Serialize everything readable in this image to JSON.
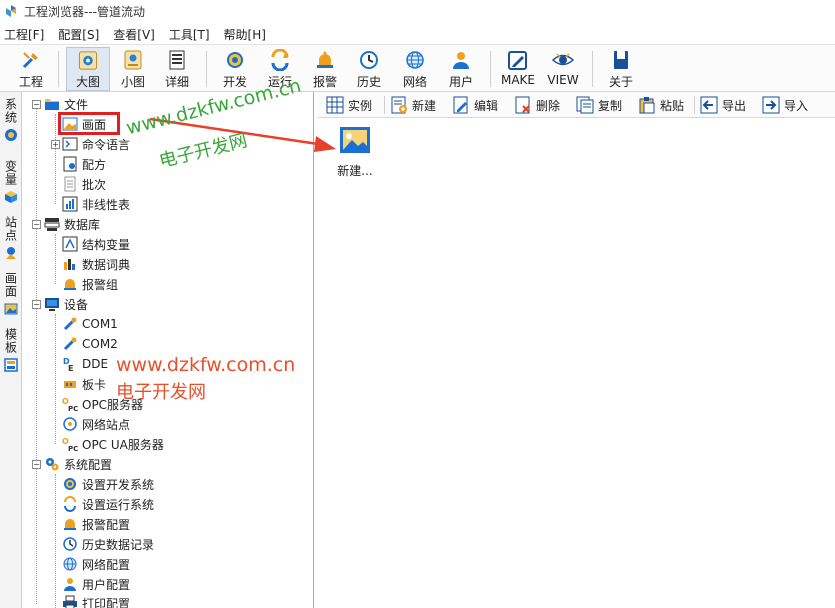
{
  "window": {
    "title": "工程浏览器---管道流动"
  },
  "menu": [
    {
      "label": "工程[F]",
      "id": "file"
    },
    {
      "label": "配置[S]",
      "id": "config"
    },
    {
      "label": "查看[V]",
      "id": "view"
    },
    {
      "label": "工具[T]",
      "id": "tools"
    },
    {
      "label": "帮助[H]",
      "id": "help"
    }
  ],
  "toolbar": {
    "project": "工程",
    "large": "大图",
    "small": "小图",
    "detail": "详细",
    "develop": "开发",
    "run": "运行",
    "alarm": "报警",
    "history": "历史",
    "network": "网络",
    "user": "用户",
    "make": "MAKE",
    "view": "VIEW",
    "about": "关于"
  },
  "vtabs": {
    "system": "系统",
    "variables": "变量",
    "sites": "站点",
    "screens": "画面",
    "templates": "模板"
  },
  "tree": {
    "file": "文件",
    "screen": "画面",
    "command": "命令语言",
    "recipe": "配方",
    "batch": "批次",
    "nonlinear": "非线性表",
    "database": "数据库",
    "struct_var": "结构变量",
    "data_dict": "数据词典",
    "alarm_group": "报警组",
    "device": "设备",
    "com1": "COM1",
    "com2": "COM2",
    "dde": "DDE",
    "board": "板卡",
    "opc": "OPC服务器",
    "net_site": "网络站点",
    "opcua": "OPC UA服务器",
    "sys_config": "系统配置",
    "set_dev": "设置开发系统",
    "set_run": "设置运行系统",
    "alarm_config": "报警配置",
    "history_record": "历史数据记录",
    "net_config": "网络配置",
    "user_config": "用户配置",
    "print_config": "打印配置"
  },
  "right_toolbar": {
    "instance": "实例",
    "new": "新建",
    "edit": "编辑",
    "delete": "删除",
    "copy": "复制",
    "paste": "粘贴",
    "export": "导出",
    "import": "导入"
  },
  "canvas": {
    "new_item": "新建..."
  },
  "watermarks": {
    "url": "www.dzkfw.com.cn",
    "name": "电子开发网"
  },
  "colors": {
    "highlight_box": "#e02020",
    "arrow": "#e8402a",
    "watermark_green": "#3aa63a",
    "watermark_red": "#e8502c"
  }
}
